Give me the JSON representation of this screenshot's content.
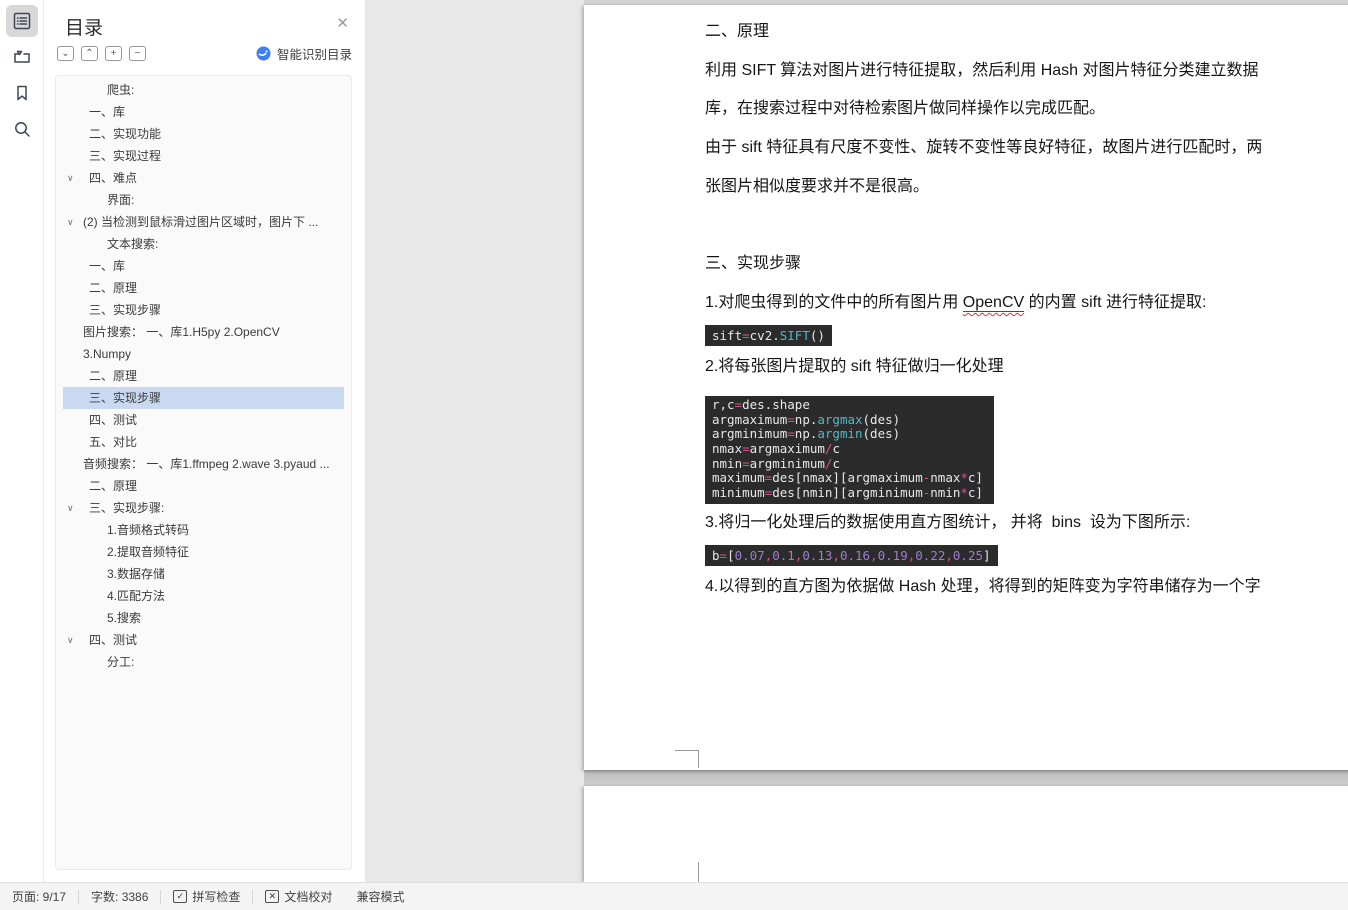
{
  "icons": {
    "close": "✕",
    "chevron_down": "⌄",
    "chevron_up": "⌃",
    "plus": "+",
    "minus": "−",
    "tree_chevron": "∨",
    "check": "✓",
    "cross": "✕"
  },
  "colors": {
    "selection_blue": "#c9d9f2",
    "smart_icon_blue": "#3d7df5",
    "code_background": "#2b2b2b",
    "code_operator": "#d0548e",
    "code_function": "#4fb9c6",
    "code_number": "#9f7cd2",
    "spellcheck_red": "#d83a3a"
  },
  "rail": {
    "items": [
      {
        "name": "toc",
        "active": true
      },
      {
        "name": "chapter-nav",
        "active": false
      },
      {
        "name": "bookmark",
        "active": false
      },
      {
        "name": "search",
        "active": false
      }
    ]
  },
  "toc_panel": {
    "title": "目录",
    "smart_label": "智能识别目录",
    "tree": [
      {
        "label": "爬虫:",
        "indent": 2
      },
      {
        "label": "一、库",
        "indent": 1
      },
      {
        "label": "二、实现功能",
        "indent": 1
      },
      {
        "label": "三、实现过程",
        "indent": 1
      },
      {
        "label": "四、难点",
        "indent": 1,
        "chevron": true
      },
      {
        "label": "界面:",
        "indent": 2
      },
      {
        "label": "(2) 当检测到鼠标滑过图片区域时，图片下 ...",
        "indent": 0,
        "chevron": true
      },
      {
        "label": "文本搜索:",
        "indent": 2
      },
      {
        "label": "一、库",
        "indent": 1
      },
      {
        "label": "二、原理",
        "indent": 1
      },
      {
        "label": "三、实现步骤",
        "indent": 1
      },
      {
        "label": "图片搜索： 一、库1.H5py 2.OpenCV",
        "indent": 0
      },
      {
        "label": "3.Numpy",
        "indent": 0
      },
      {
        "label": "二、原理",
        "indent": 1
      },
      {
        "label": "三、实现步骤",
        "indent": 1,
        "selected": true
      },
      {
        "label": "四、测试",
        "indent": 1
      },
      {
        "label": "五、对比",
        "indent": 1
      },
      {
        "label": "音频搜索： 一、库1.ffmpeg 2.wave 3.pyaud ...",
        "indent": 0
      },
      {
        "label": "二、原理",
        "indent": 1
      },
      {
        "label": "三、实现步骤:",
        "indent": 1,
        "chevron": true
      },
      {
        "label": "1.音频格式转码",
        "indent": 2
      },
      {
        "label": "2.提取音频特征",
        "indent": 2
      },
      {
        "label": "3.数据存储",
        "indent": 2
      },
      {
        "label": "4.匹配方法",
        "indent": 2
      },
      {
        "label": "5.搜索",
        "indent": 2
      },
      {
        "label": "四、测试",
        "indent": 1,
        "chevron": true
      },
      {
        "label": "分工:",
        "indent": 2
      }
    ]
  },
  "document": {
    "blocks": [
      {
        "type": "heading",
        "runs": [
          {
            "t": "二、原理"
          }
        ]
      },
      {
        "type": "line",
        "runs": [
          {
            "t": "利用 SIFT 算法对图片进行特征提取，然后利用 Hash 对图片特征分类建立数据"
          }
        ]
      },
      {
        "type": "line",
        "runs": [
          {
            "t": "库，在搜索过程中对待检索图片做同样操作以完成匹配。"
          }
        ]
      },
      {
        "type": "line",
        "runs": [
          {
            "t": "由于 sift 特征具有尺度不变性、旋转不变性等良好特征，故图片进行匹配时，两"
          }
        ]
      },
      {
        "type": "line",
        "runs": [
          {
            "t": "张图片相似度要求并不是很高。"
          }
        ]
      },
      {
        "type": "blank"
      },
      {
        "type": "heading",
        "runs": [
          {
            "t": "三、实现步骤"
          }
        ]
      },
      {
        "type": "line",
        "runs": [
          {
            "t": "1.对爬虫得到的文件中的所有图片用 "
          },
          {
            "t": "OpenCV",
            "c": "spell"
          },
          {
            "t": " 的内置 sift 进行特征提取:"
          }
        ]
      },
      {
        "type": "code-inline",
        "lines": [
          [
            {
              "t": "sift"
            },
            {
              "t": "=",
              "c": "op"
            },
            {
              "t": "cv2."
            },
            {
              "t": "SIFT",
              "c": "fn"
            },
            {
              "t": "()"
            }
          ]
        ]
      },
      {
        "type": "line",
        "runs": [
          {
            "t": "2.将每张图片提取的 sift 特征做归一化处理"
          }
        ]
      },
      {
        "type": "code-block",
        "lines": [
          [
            {
              "t": "r,c"
            },
            {
              "t": "=",
              "c": "op"
            },
            {
              "t": "des.shape"
            }
          ],
          [
            {
              "t": "argmaximum"
            },
            {
              "t": "=",
              "c": "op"
            },
            {
              "t": "np."
            },
            {
              "t": "argmax",
              "c": "fn"
            },
            {
              "t": "(des)"
            }
          ],
          [
            {
              "t": "argminimum"
            },
            {
              "t": "=",
              "c": "op"
            },
            {
              "t": "np."
            },
            {
              "t": "argmin",
              "c": "fn"
            },
            {
              "t": "(des)"
            }
          ],
          [
            {
              "t": "nmax"
            },
            {
              "t": "=",
              "c": "op"
            },
            {
              "t": "argmaximum"
            },
            {
              "t": "/",
              "c": "op"
            },
            {
              "t": "c"
            }
          ],
          [
            {
              "t": "nmin"
            },
            {
              "t": "=",
              "c": "op"
            },
            {
              "t": "argminimum"
            },
            {
              "t": "/",
              "c": "op"
            },
            {
              "t": "c"
            }
          ],
          [
            {
              "t": "maximum"
            },
            {
              "t": "=",
              "c": "op"
            },
            {
              "t": "des[nmax][argmaximum"
            },
            {
              "t": "-",
              "c": "op"
            },
            {
              "t": "nmax"
            },
            {
              "t": "*",
              "c": "op"
            },
            {
              "t": "c]"
            }
          ],
          [
            {
              "t": "minimum"
            },
            {
              "t": "=",
              "c": "op"
            },
            {
              "t": "des[nmin][argminimum"
            },
            {
              "t": "-",
              "c": "op"
            },
            {
              "t": "nmin"
            },
            {
              "t": "*",
              "c": "op"
            },
            {
              "t": "c]"
            }
          ]
        ]
      },
      {
        "type": "line",
        "runs": [
          {
            "t": "3.将归一化处理后的数据使用直方图统计， 并将  bins  设为下图所示:"
          }
        ]
      },
      {
        "type": "code-inline",
        "lines": [
          [
            {
              "t": "b"
            },
            {
              "t": "=",
              "c": "op"
            },
            {
              "t": "["
            },
            {
              "t": "0.07",
              "c": "num"
            },
            {
              "t": ",",
              "c": "op"
            },
            {
              "t": "0.1",
              "c": "num"
            },
            {
              "t": ",",
              "c": "op"
            },
            {
              "t": "0.13",
              "c": "num"
            },
            {
              "t": ",",
              "c": "op"
            },
            {
              "t": "0.16",
              "c": "num"
            },
            {
              "t": ",",
              "c": "op"
            },
            {
              "t": "0.19",
              "c": "num"
            },
            {
              "t": ",",
              "c": "op"
            },
            {
              "t": "0.22",
              "c": "num"
            },
            {
              "t": ",",
              "c": "op"
            },
            {
              "t": "0.25",
              "c": "num"
            },
            {
              "t": "]"
            }
          ]
        ]
      },
      {
        "type": "line",
        "runs": [
          {
            "t": "4.以得到的直方图为依据做 Hash 处理，将得到的矩阵变为字符串储存为一个字"
          }
        ]
      }
    ]
  },
  "status_bar": {
    "page": "页面: 9/17",
    "words": "字数: 3386",
    "spell": "拼写检查",
    "proof": "文档校对",
    "compat": "兼容模式"
  }
}
